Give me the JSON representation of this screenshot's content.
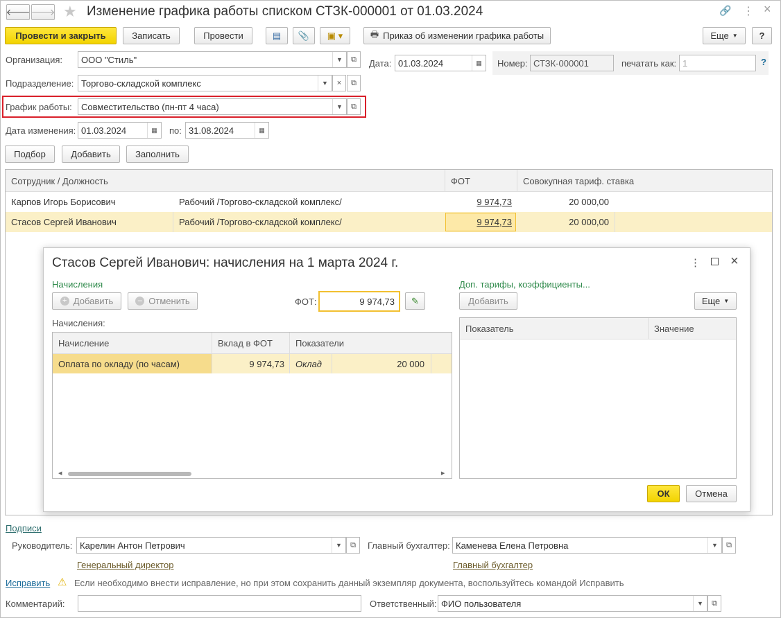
{
  "title": "Изменение графика работы списком СТЗК-000001 от 01.03.2024",
  "toolbar": {
    "post_close": "Провести и закрыть",
    "save": "Записать",
    "post": "Провести",
    "print_order": "Приказ об изменении графика работы",
    "more": "Еще",
    "help": "?"
  },
  "header": {
    "org_label": "Организация:",
    "org_value": "ООО \"Стиль\"",
    "date_label": "Дата:",
    "date_value": "01.03.2024",
    "number_label": "Номер:",
    "number_value": "СТЗК-000001",
    "print_as_label": "печатать как:",
    "print_as_placeholder": "1",
    "help_q": "?",
    "dept_label": "Подразделение:",
    "dept_value": "Торгово-складской комплекс",
    "schedule_label": "График работы:",
    "schedule_value": "Совместительство (пн-пт 4 часа)",
    "change_date_label": "Дата изменения:",
    "change_date_value": "01.03.2024",
    "to_label": "по:",
    "to_value": "31.08.2024"
  },
  "table_buttons": {
    "pick": "Подбор",
    "add": "Добавить",
    "fill": "Заполнить"
  },
  "main_table": {
    "headers": [
      "Сотрудник / Должность",
      "ФОТ",
      "Совокупная тариф. ставка"
    ],
    "rows": [
      {
        "employee": "Карпов Игорь Борисович",
        "position": "Рабочий /Торгово-складской комплекс/",
        "fot": "9 974,73",
        "rate": "20 000,00"
      },
      {
        "employee": "Стасов Сергей Иванович",
        "position": "Рабочий /Торгово-складской комплекс/",
        "fot": "9 974,73",
        "rate": "20 000,00"
      }
    ]
  },
  "dialog": {
    "title": "Стасов Сергей Иванович: начисления на 1 марта 2024 г.",
    "accruals_group": "Начисления",
    "add": "Добавить",
    "cancel": "Отменить",
    "fot_label": "ФОТ:",
    "fot_value": "9 974,73",
    "accruals_label": "Начисления:",
    "grid_headers": [
      "Начисление",
      "Вклад в ФОТ",
      "Показатели"
    ],
    "grid_rows": [
      {
        "accrual": "Оплата по окладу (по часам)",
        "contribution": "9 974,73",
        "indicator": "Оклад",
        "value": "20 000"
      }
    ],
    "extra_group": "Доп. тарифы, коэффициенты...",
    "extra_add": "Добавить",
    "extra_more": "Еще",
    "extra_headers": [
      "Показатель",
      "Значение"
    ],
    "ok": "ОК",
    "close_cancel": "Отмена"
  },
  "footer": {
    "signatures_link": "Подписи",
    "manager_label": "Руководитель:",
    "manager_value": "Карелин Антон Петрович",
    "manager_position": "Генеральный директор",
    "accountant_label": "Главный бухгалтер:",
    "accountant_value": "Каменева Елена Петровна",
    "accountant_position": "Главный бухгалтер",
    "fix_link": "Исправить",
    "fix_note": "Если необходимо внести исправление, но при этом сохранить данный экземпляр документа, воспользуйтесь командой Исправить",
    "comment_label": "Комментарий:",
    "comment_value": "",
    "responsible_label": "Ответственный:",
    "responsible_value": "ФИО пользователя"
  },
  "colors": {
    "accent_yellow": "#f2d300",
    "selected_row": "#fbf0c7",
    "red_highlight": "#d9202a",
    "link_blue": "#1a6b99",
    "group_green": "#2f8a4b"
  }
}
